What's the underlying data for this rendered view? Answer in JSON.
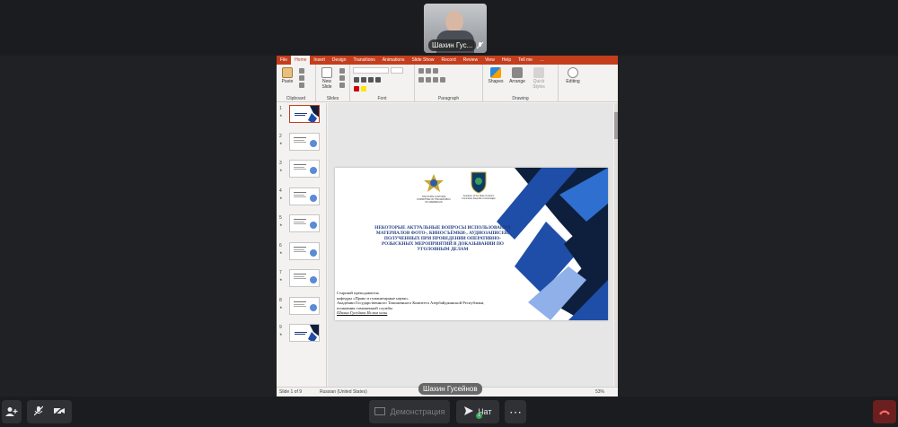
{
  "participant": {
    "name": "Шахин Гус..."
  },
  "ppt": {
    "tabs": [
      "File",
      "Home",
      "Insert",
      "Design",
      "Transitions",
      "Animations",
      "Slide Show",
      "Record",
      "Review",
      "View",
      "Help",
      "Tell me",
      "…"
    ],
    "active_tab": "Home",
    "groups": {
      "clipboard": "Clipboard",
      "slides": "Slides",
      "font": "Font",
      "paragraph": "Paragraph",
      "drawing": "Drawing"
    },
    "buttons": {
      "paste": "Paste",
      "new_slide": "New Slide",
      "shapes": "Shapes",
      "arrange": "Arrange",
      "quick_styles": "Quick Styles",
      "editing": "Editing"
    },
    "thumbnails": [
      "1",
      "2",
      "3",
      "4",
      "5",
      "6",
      "7",
      "8",
      "9"
    ],
    "status": {
      "slide": "Slide 1 of 9",
      "lang": "Russian (United States)",
      "zoom": "53%"
    }
  },
  "slide": {
    "logo1_caption": "THE STATE CUSTOMS COMMITTEE OF THE REPUBLIC OF AZERBAIJAN",
    "logo2_caption": "Academy of the State Customs Committee Republic of Azerbaijan",
    "title": "НЕКОТОРЫЕ АКТУАЛЬНЫЕ ВОПРОСЫ ИСПОЛЬЗОВАНИЯ МАТЕРИАЛОВ ФОТО-, КИНОСЪЁМКИ-, АУДИОЗАПИСЕЙ, ПОЛУЧЕННЫХ ПРИ ПРОВЕДЕНИИ ОПЕРАТИВНО-РОЗЫСКНЫХ МЕРОПРИЯТИЙ В ДОКАЗЫВАНИИ ПО УГОЛОВНЫМ ДЕЛАМ",
    "author_line1": "Старший преподаватель",
    "author_line2": "кафедры «Право и гуманитарные науки»",
    "author_line3": "Академии Государственного Таможенного Комитета Азербайджанской Республики,",
    "author_line4": "полковник таможенной службы",
    "author_name": "Шахин Гусейнов Ислам оглы"
  },
  "presenter_label": "Шахин Гусейнов",
  "controls": {
    "share_label": "Демонстрация",
    "chat_label": "Чат",
    "chat_badge": "1",
    "more_label": "⋯"
  },
  "colors": {
    "ppt_accent": "#c43e1c",
    "slide_blue": "#1f4ea8",
    "slide_navy": "#0e1f3d",
    "hangup": "#6b1f1f"
  }
}
